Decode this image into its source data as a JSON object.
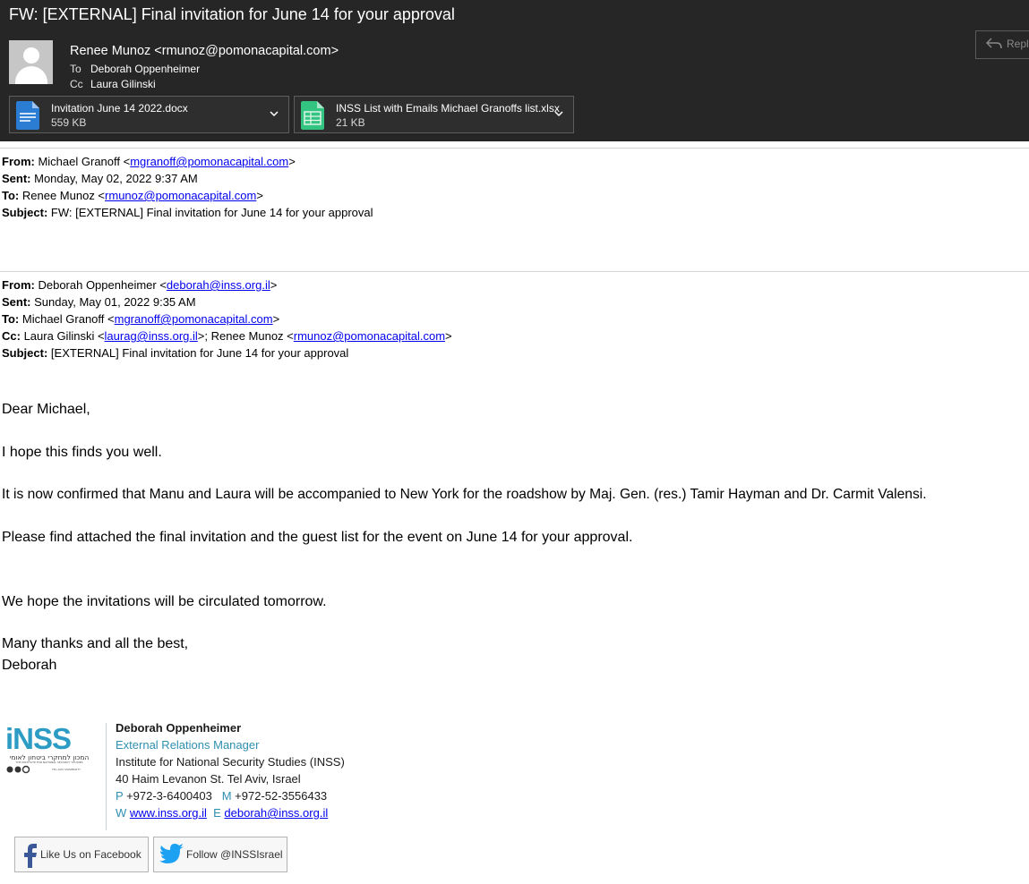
{
  "window": {
    "subject": "FW: [EXTERNAL] Final invitation for June 14 for your approval",
    "reply_label": "Reply"
  },
  "message": {
    "sender": "Renee Munoz <rmunoz@pomonacapital.com>",
    "to_label": "To",
    "to": "Deborah Oppenheimer",
    "cc_label": "Cc",
    "cc": "Laura Gilinski"
  },
  "attachments": [
    {
      "name": "Invitation June 14 2022.docx",
      "size": "559 KB",
      "icon": "word-doc-icon",
      "color": "#2b7cd3"
    },
    {
      "name": "INSS List with Emails Michael Granoffs list.xlsx",
      "size": "21 KB",
      "icon": "excel-sheet-icon",
      "color": "#33c481"
    }
  ],
  "forward1": {
    "from_label": "From:",
    "from_name": "Michael Granoff <",
    "from_email": "mgranoff@pomonacapital.com",
    "from_end": ">",
    "sent_label": "Sent:",
    "sent": "Monday, May 02, 2022 9:37 AM",
    "to_label": "To:",
    "to_name": "Renee Munoz <",
    "to_email": "rmunoz@pomonacapital.com",
    "to_end": ">",
    "subject_label": "Subject:",
    "subject": "FW: [EXTERNAL] Final invitation for June 14 for your approval"
  },
  "forward2": {
    "from_label": "From:",
    "from_name": "Deborah Oppenheimer <",
    "from_email": "deborah@inss.org.il",
    "from_end": ">",
    "sent_label": "Sent:",
    "sent": "Sunday, May 01, 2022 9:35 AM",
    "to_label": "To:",
    "to_name": "Michael Granoff <",
    "to_email": "mgranoff@pomonacapital.com",
    "to_end": ">",
    "cc_label": "Cc:",
    "cc_name1": "Laura Gilinski <",
    "cc_email1": "laurag@inss.org.il",
    "cc_mid": ">; Renee Munoz <",
    "cc_email2": "rmunoz@pomonacapital.com",
    "cc_end": ">",
    "subject_label": "Subject:",
    "subject": "[EXTERNAL] Final invitation for June 14 for your approval"
  },
  "body": {
    "greeting": "Dear Michael,",
    "p1": "I hope this finds you well.",
    "p2": "It is now confirmed that Manu and Laura will be accompanied to New York for the roadshow by Maj. Gen. (res.) Tamir Hayman and Dr. Carmit Valensi.",
    "p3": "Please find attached the final invitation and the guest list for the event on June 14 for your approval.",
    "p4": "We hope the invitations will be circulated tomorrow.",
    "closing": "Many thanks and all the best,",
    "signoff": "Deborah"
  },
  "signature": {
    "logo_text": "iNSS",
    "logo_hebrew": "המכון למחקרי ביטחון לאומי",
    "logo_english": "THE INSTITUTE FOR NATIONAL SECURITY STUDIES",
    "logo_university": "TEL AVIV UNIVERSITY",
    "name": "Deborah Oppenheimer",
    "title": "External Relations Manager",
    "org": "Institute for National Security Studies (INSS)",
    "address": "40 Haim Levanon St. Tel Aviv, Israel",
    "phone_prefix": "P",
    "phone": "+972-3-6400403",
    "mobile_prefix": "M",
    "mobile": "+972-52-3556433",
    "web_prefix": "W",
    "web": "www.inss.org.il",
    "email_prefix": "E",
    "email": "deborah@inss.org.il"
  },
  "social": {
    "facebook": "Like Us on Facebook",
    "twitter": "Follow @INSSIsrael"
  }
}
